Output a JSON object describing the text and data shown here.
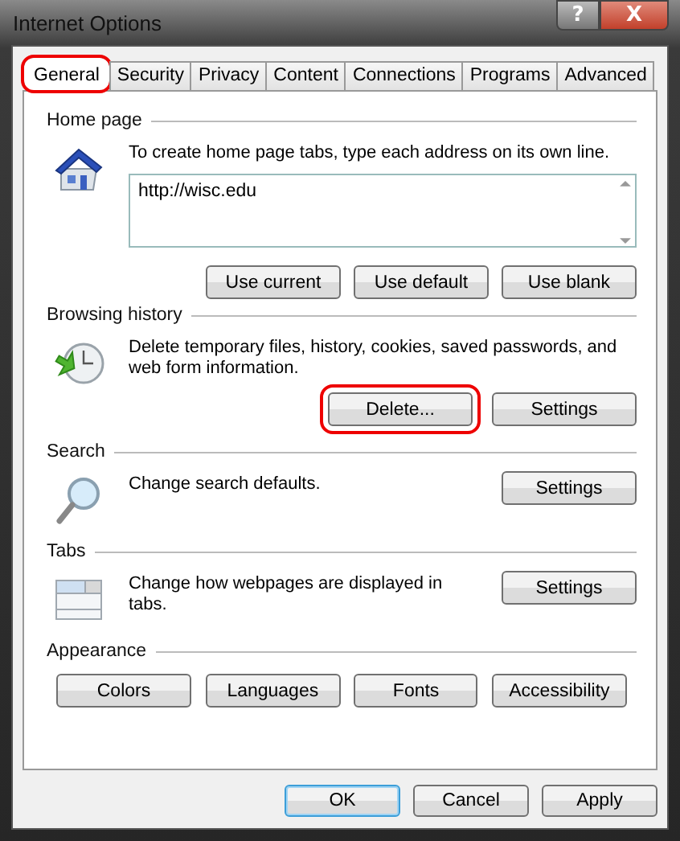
{
  "window": {
    "title": "Internet Options",
    "title_buttons": [
      {
        "kind": "help",
        "label": "?"
      },
      {
        "kind": "close",
        "label": "X"
      }
    ]
  },
  "tabs": [
    {
      "label": "General",
      "selected": true,
      "highlighted": true
    },
    {
      "label": "Security",
      "selected": false,
      "highlighted": false
    },
    {
      "label": "Privacy",
      "selected": false,
      "highlighted": false
    },
    {
      "label": "Content",
      "selected": false,
      "highlighted": false
    },
    {
      "label": "Connections",
      "selected": false,
      "highlighted": false
    },
    {
      "label": "Programs",
      "selected": false,
      "highlighted": false
    },
    {
      "label": "Advanced",
      "selected": false,
      "highlighted": false
    }
  ],
  "sections": [
    {
      "kind": "homepage",
      "title": "Home page",
      "text": "To create home page tabs, type each address on its own line.",
      "addresses": "http://wisc.edu",
      "buttons": [
        {
          "label": "Use current",
          "highlighted": false
        },
        {
          "label": "Use default",
          "highlighted": false
        },
        {
          "label": "Use blank",
          "highlighted": false
        }
      ]
    },
    {
      "kind": "history",
      "title": "Browsing history",
      "text": "Delete temporary files, history, cookies, saved passwords, and web form information.",
      "buttons": [
        {
          "label": "Delete...",
          "highlighted": true
        },
        {
          "label": "Settings",
          "highlighted": false
        }
      ]
    },
    {
      "kind": "search",
      "title": "Search",
      "text": "Change search defaults.",
      "buttons": [
        {
          "label": "Settings",
          "highlighted": false
        }
      ]
    },
    {
      "kind": "tabs",
      "title": "Tabs",
      "text": "Change how webpages are displayed in tabs.",
      "buttons": [
        {
          "label": "Settings",
          "highlighted": false
        }
      ]
    },
    {
      "kind": "appearance",
      "title": "Appearance",
      "buttons": [
        {
          "label": "Colors",
          "highlighted": false
        },
        {
          "label": "Languages",
          "highlighted": false
        },
        {
          "label": "Fonts",
          "highlighted": false
        },
        {
          "label": "Accessibility",
          "highlighted": false
        }
      ]
    }
  ],
  "dialog_buttons": [
    {
      "label": "OK",
      "default": true
    },
    {
      "label": "Cancel",
      "default": false
    },
    {
      "label": "Apply",
      "default": false
    }
  ]
}
